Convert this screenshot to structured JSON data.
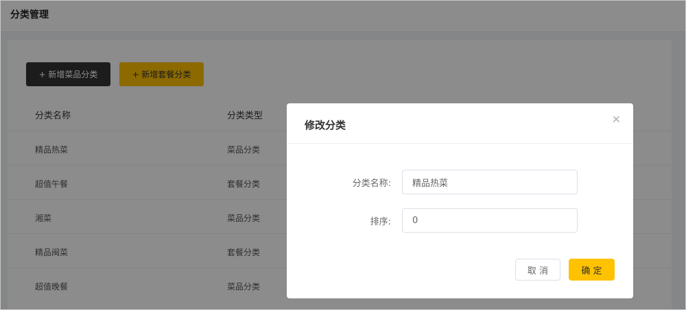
{
  "header": {
    "title": "分类管理"
  },
  "toolbar": {
    "add_dish_category": "+ 新增菜品分类",
    "add_combo_category": "+ 新增套餐分类"
  },
  "table": {
    "columns": [
      "分类名称",
      "分类类型"
    ],
    "rows": [
      {
        "name": "精品热菜",
        "type": "菜品分类"
      },
      {
        "name": "超值午餐",
        "type": "套餐分类"
      },
      {
        "name": "湘菜",
        "type": "菜品分类"
      },
      {
        "name": "精品闽菜",
        "type": "套餐分类"
      },
      {
        "name": "超值晚餐",
        "type": "菜品分类"
      }
    ]
  },
  "dialog": {
    "title": "修改分类",
    "close_icon": "close-icon",
    "fields": {
      "name_label": "分类名称:",
      "name_value": "精品热菜",
      "sort_label": "排序:",
      "sort_value": "0"
    },
    "cancel_label": "取 消",
    "confirm_label": "确 定"
  },
  "colors": {
    "accent": "#ffc200",
    "dark_button": "#333333",
    "overlay": "rgba(0,0,0,0.45)"
  }
}
